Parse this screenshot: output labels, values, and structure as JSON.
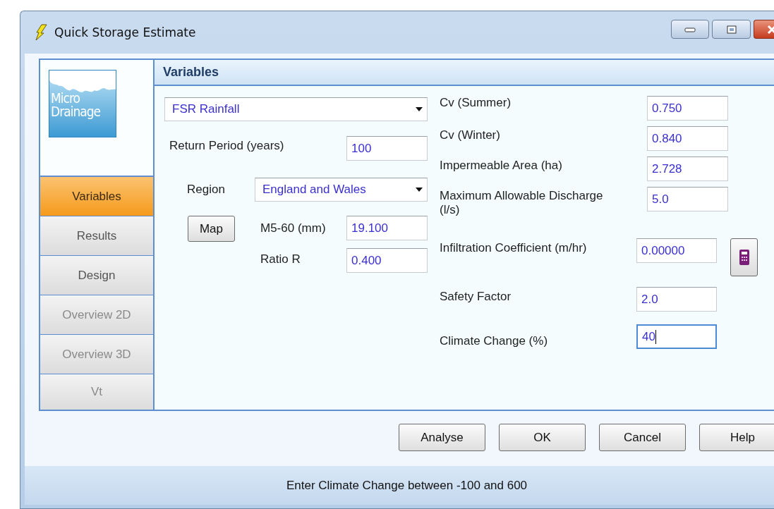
{
  "window": {
    "title": "Quick Storage Estimate"
  },
  "logo": {
    "lines": [
      "Micro",
      "Drainage"
    ]
  },
  "nav": [
    {
      "label": "Variables",
      "selected": true,
      "disabled": false
    },
    {
      "label": "Results",
      "selected": false,
      "disabled": false
    },
    {
      "label": "Design",
      "selected": false,
      "disabled": false
    },
    {
      "label": "Overview 2D",
      "selected": false,
      "disabled": true
    },
    {
      "label": "Overview 3D",
      "selected": false,
      "disabled": true
    },
    {
      "label": "Vt",
      "selected": false,
      "disabled": true
    }
  ],
  "panel": {
    "title": "Variables"
  },
  "rainfall_type": {
    "value": "FSR Rainfall"
  },
  "return_period": {
    "label": "Return Period (years)",
    "value": "100"
  },
  "region": {
    "label": "Region",
    "value": "England and Wales"
  },
  "map_button": "Map",
  "m5_60": {
    "label": "M5-60 (mm)",
    "value": "19.100"
  },
  "ratio_r": {
    "label": "Ratio R",
    "value": "0.400"
  },
  "upper_fields": [
    {
      "label": "Cv (Summer)",
      "value": "0.750",
      "focused": false
    },
    {
      "label": "Cv (Winter)",
      "value": "0.840",
      "focused": false
    },
    {
      "label": "Impermeable Area (ha)",
      "value": "2.728",
      "focused": false
    },
    {
      "label": "Maximum Allowable Discharge (l/s)",
      "value": "5.0",
      "focused": false
    }
  ],
  "lower_fields": [
    {
      "label": "Infiltration Coefficient (m/hr)",
      "value": "0.00000",
      "focused": false
    },
    {
      "label": "Safety Factor",
      "value": "2.0",
      "focused": false
    },
    {
      "label": "Climate Change (%)",
      "value": "40",
      "focused": true
    }
  ],
  "buttons": [
    "Analyse",
    "OK",
    "Cancel",
    "Help"
  ],
  "status_bar": "Enter Climate Change between -100 and 600"
}
